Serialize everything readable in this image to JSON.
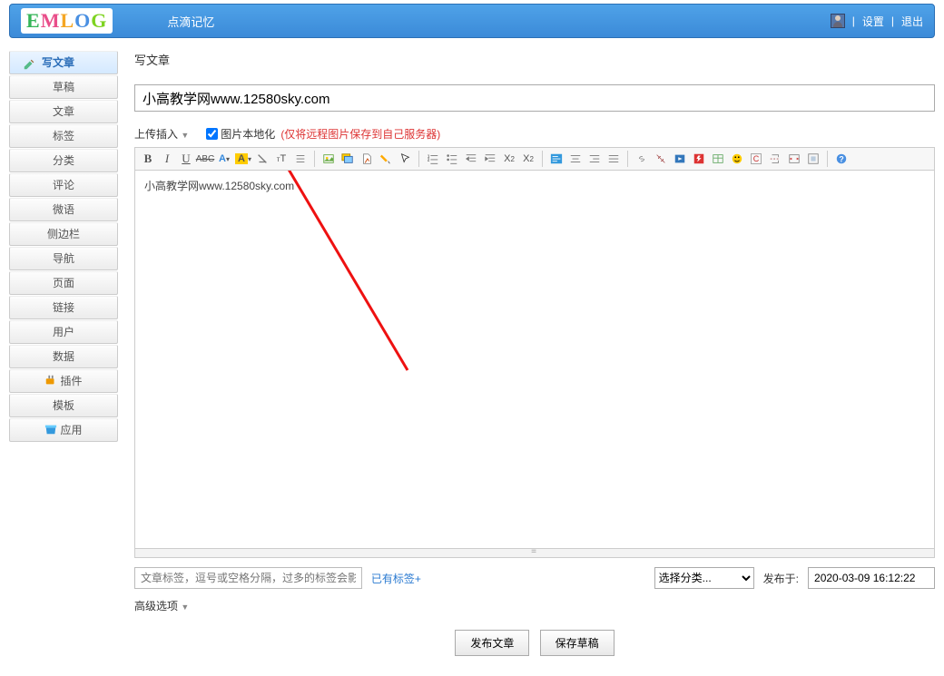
{
  "header": {
    "logo_text": "EMLOG",
    "slogan": "点滴记忆",
    "settings": "设置",
    "logout": "退出"
  },
  "sidebar": {
    "items": [
      {
        "label": "写文章",
        "active": true,
        "icon": "pencil"
      },
      {
        "label": "草稿"
      },
      {
        "label": "文章"
      },
      {
        "label": "标签"
      },
      {
        "label": "分类"
      },
      {
        "label": "评论"
      },
      {
        "label": "微语"
      },
      {
        "label": "侧边栏"
      },
      {
        "label": "导航"
      },
      {
        "label": "页面"
      },
      {
        "label": "链接"
      },
      {
        "label": "用户"
      },
      {
        "label": "数据"
      },
      {
        "label": "插件",
        "icon": "plugin"
      },
      {
        "label": "模板"
      },
      {
        "label": "应用",
        "icon": "store"
      }
    ]
  },
  "page": {
    "title": "写文章",
    "post_title_value": "小高教学网www.12580sky.com",
    "upload_label": "上传插入",
    "local_image_checkbox_label": "图片本地化",
    "local_image_hint": "(仅将远程图片保存到自己服务器)",
    "editor_content": "小高教学网www.12580sky.com",
    "tags_placeholder": "文章标签，逗号或空格分隔，过多的标签会影响系统运行效率",
    "existing_tags_link": "已有标签+",
    "category_placeholder": "选择分类...",
    "publish_label": "发布于:",
    "publish_date_value": "2020-03-09 16:12:22",
    "advanced_label": "高级选项",
    "publish_btn": "发布文章",
    "draft_btn": "保存草稿"
  },
  "toolbar_icons": [
    "bold",
    "italic",
    "underline",
    "strike",
    "forecolor",
    "drop1",
    "backcolor",
    "drop2",
    "removeformat",
    "fontsize",
    "lineheight",
    "sep",
    "image",
    "multiimage",
    "insertfile",
    "paint",
    "cursor",
    "sep",
    "ol",
    "ul",
    "indent",
    "outdent",
    "sub",
    "sup",
    "sep",
    "alignleft",
    "aligncenter",
    "alignright",
    "alignjustify",
    "sep",
    "link",
    "unlink",
    "media",
    "flash",
    "table",
    "emoji",
    "code",
    "pagebreak",
    "source",
    "fullscreen",
    "sep",
    "help"
  ]
}
